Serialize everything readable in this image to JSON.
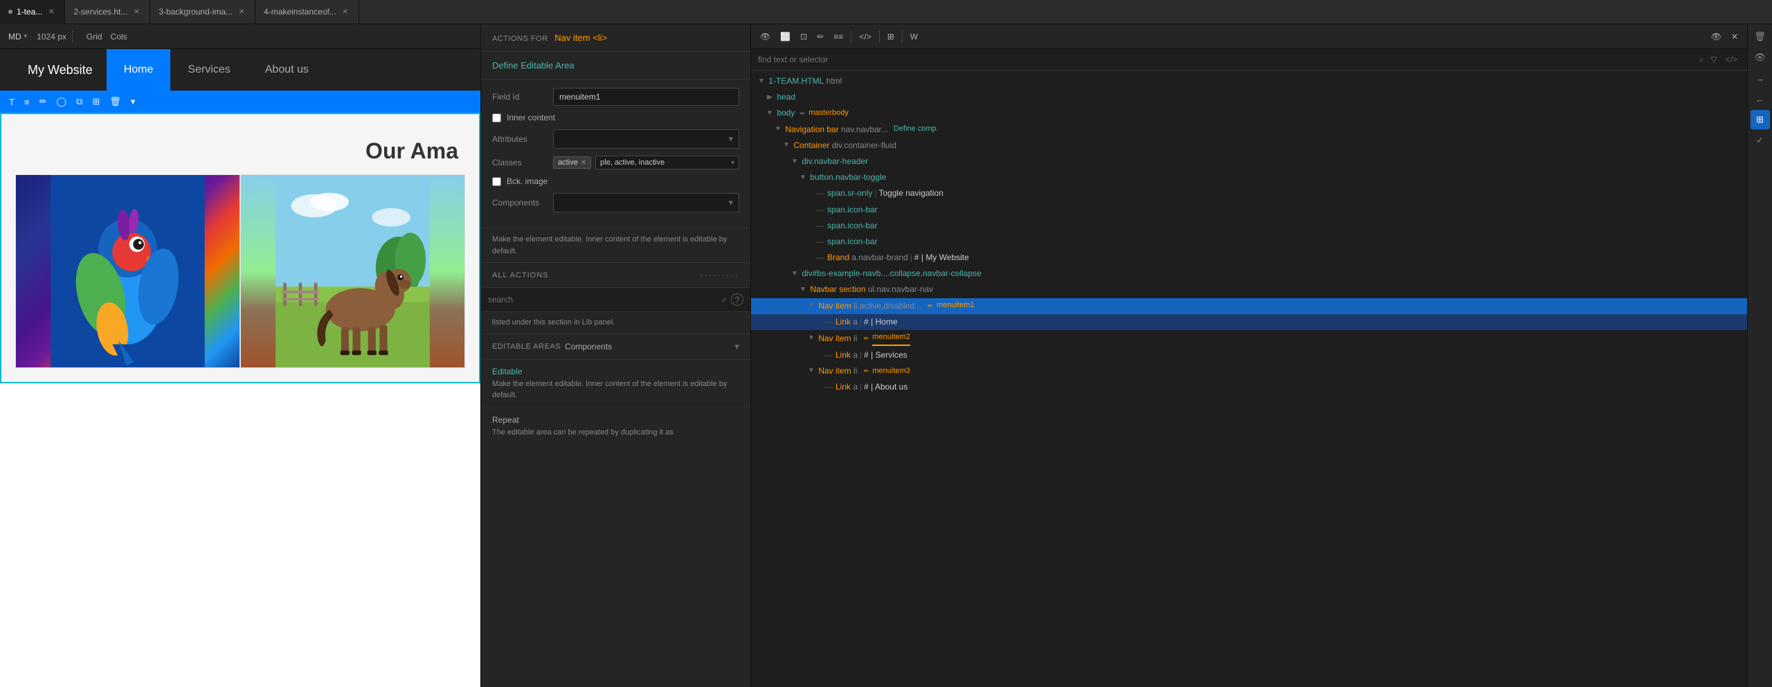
{
  "tabs": [
    {
      "id": "tab1",
      "label": "1-tea...",
      "active": true,
      "dot": true,
      "modified": true
    },
    {
      "id": "tab2",
      "label": "2-services.ht...",
      "active": false,
      "dot": false,
      "modified": true
    },
    {
      "id": "tab3",
      "label": "3-background-ima...",
      "active": false,
      "dot": false,
      "modified": false
    },
    {
      "id": "tab4",
      "label": "4-makeinstanceof...",
      "active": false,
      "dot": false,
      "modified": false
    }
  ],
  "preview_toolbar": {
    "breakpoint": "MD",
    "px": "1024 px",
    "grid": "Grid",
    "cols": "Cols"
  },
  "site": {
    "brand": "My Website",
    "nav_items": [
      {
        "label": "Home",
        "active": true
      },
      {
        "label": "Services",
        "active": false
      },
      {
        "label": "About us",
        "active": false
      }
    ],
    "hero_title": "Our Ama"
  },
  "selection_tools": [
    {
      "icon": "T",
      "title": "text"
    },
    {
      "icon": "≡",
      "title": "align"
    },
    {
      "icon": "✏",
      "title": "edit"
    },
    {
      "icon": "🔗",
      "title": "link"
    },
    {
      "icon": "⧉",
      "title": "copy"
    },
    {
      "icon": "⊞",
      "title": "grid"
    },
    {
      "icon": "🗑",
      "title": "delete"
    },
    {
      "icon": "▾",
      "title": "more"
    }
  ],
  "actions_panel": {
    "header_label": "ACTIONS FOR",
    "header_target": "Nav item <li>",
    "define_editable_label": "Define Editable Area",
    "field_id_label": "Field Id",
    "field_id_value": "menuitem1",
    "inner_content_label": "Inner content",
    "attributes_label": "Attributes",
    "classes_label": "Classes",
    "class_tag": "active",
    "class_placeholder": "ple, active, inactive",
    "bck_image_label": "Bck. image",
    "components_label": "Components",
    "description": "Make the element editable. Inner content of the element is editable by default.",
    "all_actions_title": "ALL ACTIONS",
    "search_placeholder": "search",
    "listed_text": "listed under this section in Lib panel.",
    "editable_areas_title": "EDITABLE AREAS",
    "editable_areas_components": "Components",
    "ea_editable_title": "Editable",
    "ea_editable_desc": "Make the element editable. Inner content of the element is editable by default.",
    "ea_repeat_title": "Repeat",
    "ea_repeat_desc": "The editable area can be repeated by duplicating it as"
  },
  "dom_panel": {
    "search_placeholder": "find text or selector",
    "tree": [
      {
        "id": "html-root",
        "level": 0,
        "toggle": "▼",
        "tag_name": "1-TEAM.HTML",
        "tag_rest": " html",
        "color": "teal"
      },
      {
        "id": "head",
        "level": 1,
        "toggle": "▶",
        "tag_name": "head",
        "color": "blue"
      },
      {
        "id": "body",
        "level": 1,
        "toggle": "▼",
        "tag_name": "body",
        "tag_after_edit": "masterbody",
        "color": "blue",
        "edit_icon": true
      },
      {
        "id": "navbar",
        "level": 2,
        "toggle": "▼",
        "tag_name": "Navigation bar",
        "tag_rest": " nav.navbar...",
        "define_comp": "Define comp.",
        "color": "orange"
      },
      {
        "id": "container",
        "level": 3,
        "toggle": "▼",
        "tag_name": "Container",
        "tag_rest": " div.container-fluid",
        "color": "orange"
      },
      {
        "id": "navbar-header",
        "level": 4,
        "toggle": "▼",
        "tag_name": "div.navbar-header",
        "color": "blue"
      },
      {
        "id": "navbar-toggle",
        "level": 5,
        "toggle": "▼",
        "tag_name": "button.navbar-toggle",
        "color": "blue"
      },
      {
        "id": "span-sr-only",
        "level": 6,
        "dash": true,
        "tag_name": "span.sr-only",
        "pipe_text": "Toggle navigation",
        "color": "blue"
      },
      {
        "id": "span-icon-bar1",
        "level": 6,
        "dash": true,
        "tag_name": "span.icon-bar",
        "color": "blue"
      },
      {
        "id": "span-icon-bar2",
        "level": 6,
        "dash": true,
        "tag_name": "span.icon-bar",
        "color": "blue"
      },
      {
        "id": "span-icon-bar3",
        "level": 6,
        "dash": true,
        "tag_name": "span.icon-bar",
        "color": "blue"
      },
      {
        "id": "brand",
        "level": 6,
        "dash": true,
        "tag_name": "Brand",
        "tag_rest": " a.navbar-brand",
        "pipe_text": "# | My Website",
        "color": "orange"
      },
      {
        "id": "div-collapse",
        "level": 4,
        "toggle": "▼",
        "tag_name": "div#bs-example-navb....collapse.navbar-collapse",
        "color": "blue"
      },
      {
        "id": "navbar-nav",
        "level": 5,
        "toggle": "▼",
        "tag_name": "Navbar section",
        "tag_rest": " ul.nav.navbar-nav",
        "color": "orange"
      },
      {
        "id": "nav-item1",
        "level": 6,
        "toggle": "▼",
        "tag_name": "Nav item",
        "tag_rest": " li.active,disabled...",
        "edit_name": "menuitem1",
        "color": "orange",
        "selected": true
      },
      {
        "id": "nav-link1",
        "level": 7,
        "dash": true,
        "tag_name": "Link",
        "tag_rest": " a",
        "pipe_text": "# | Home",
        "color": "orange"
      },
      {
        "id": "nav-item2",
        "level": 6,
        "toggle": "▼",
        "tag_name": "Nav item",
        "tag_rest": " li",
        "edit_name": "menuitem2",
        "color": "orange",
        "underline": true
      },
      {
        "id": "nav-link2",
        "level": 7,
        "dash": true,
        "tag_name": "Link",
        "tag_rest": " a",
        "pipe_text": "# | Services",
        "color": "orange"
      },
      {
        "id": "nav-item3",
        "level": 6,
        "toggle": "▼",
        "tag_name": "Nav item",
        "tag_rest": " li",
        "edit_name": "menuitem3",
        "color": "orange"
      },
      {
        "id": "nav-link3",
        "level": 7,
        "dash": true,
        "tag_name": "Link",
        "tag_rest": " a",
        "pipe_text": "# | About us",
        "color": "orange"
      }
    ]
  },
  "right_sidebar_icons": [
    {
      "name": "trash-icon",
      "symbol": "🗑"
    },
    {
      "name": "eye-icon",
      "symbol": "👁"
    },
    {
      "name": "arrow-icon",
      "symbol": "→"
    },
    {
      "name": "left-arrow-icon",
      "symbol": "←"
    },
    {
      "name": "grid-icon",
      "symbol": "⊞"
    },
    {
      "name": "check-icon",
      "symbol": "✓"
    }
  ],
  "dom_toolbar_icons": [
    {
      "name": "view-icon",
      "symbol": "👁",
      "active": false
    },
    {
      "name": "tablet-icon",
      "symbol": "⬜",
      "active": false
    },
    {
      "name": "layout-icon",
      "symbol": "⊡",
      "active": false
    },
    {
      "name": "brush-icon",
      "symbol": "✏",
      "active": false
    },
    {
      "name": "format-icon",
      "symbol": "≡≡",
      "active": false
    },
    {
      "name": "code-icon",
      "symbol": "</>",
      "active": false
    },
    {
      "name": "component-icon",
      "symbol": "⊞",
      "active": false
    },
    {
      "name": "wp-icon",
      "symbol": "W",
      "active": false
    },
    {
      "name": "eye2-icon",
      "symbol": "👁",
      "active": false
    },
    {
      "name": "close-icon",
      "symbol": "✕",
      "active": false
    }
  ]
}
